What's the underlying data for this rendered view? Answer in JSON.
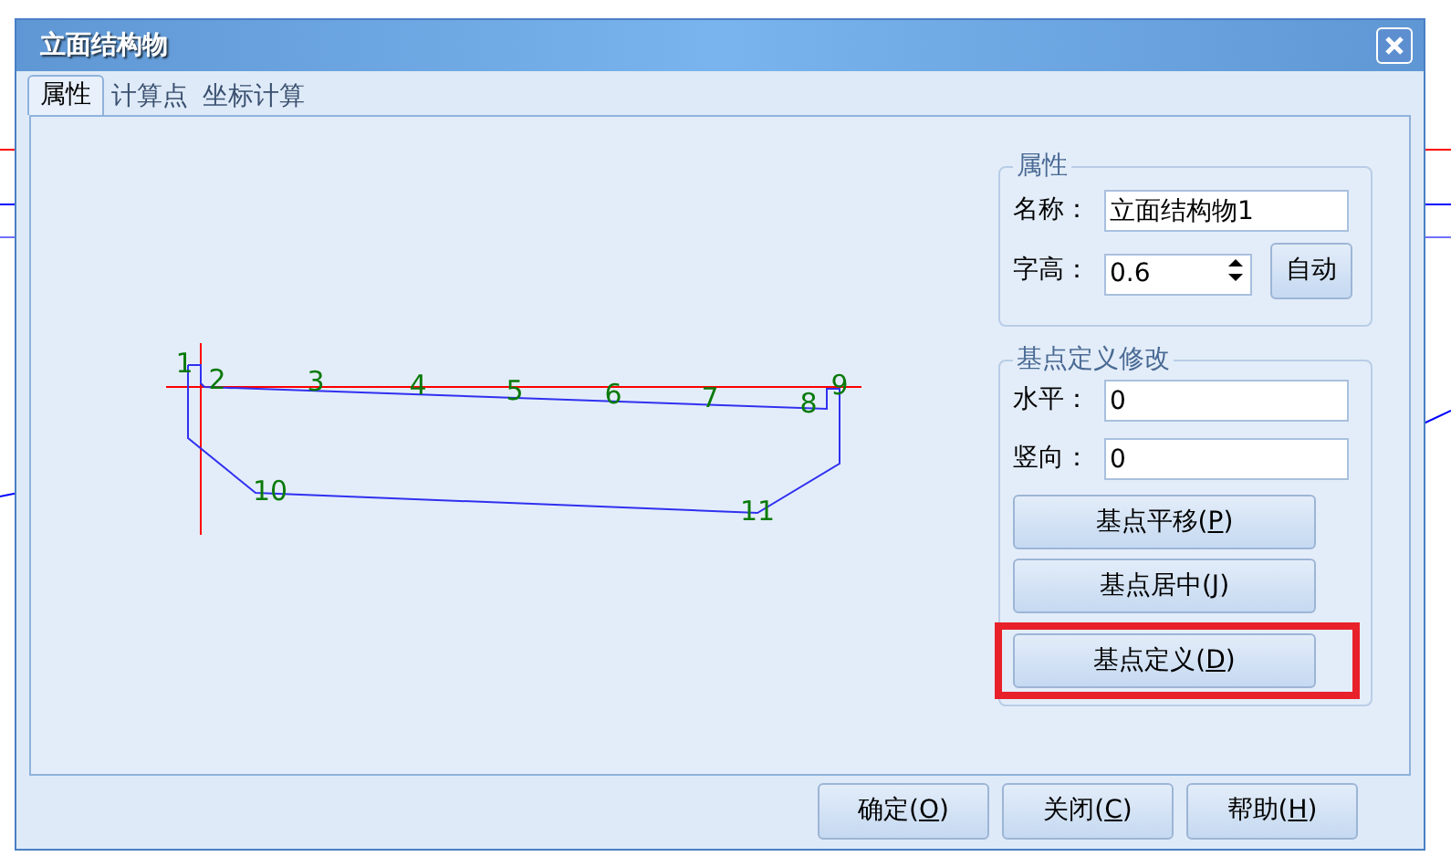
{
  "window": {
    "title": "立面结构物"
  },
  "tabs": [
    {
      "label": "属性",
      "selected": true
    },
    {
      "label": "计算点",
      "selected": false
    },
    {
      "label": "坐标计算",
      "selected": false
    }
  ],
  "points": [
    {
      "label": "1"
    },
    {
      "label": "2"
    },
    {
      "label": "3"
    },
    {
      "label": "4"
    },
    {
      "label": "5"
    },
    {
      "label": "6"
    },
    {
      "label": "7"
    },
    {
      "label": "8"
    },
    {
      "label": "9"
    },
    {
      "label": "10"
    },
    {
      "label": "11"
    }
  ],
  "properties": {
    "legend": "属性",
    "name_label": "名称：",
    "name_value": "立面结构物1",
    "height_label": "字高：",
    "height_value": "0.6",
    "auto_button": "自动"
  },
  "base_point": {
    "legend": "基点定义修改",
    "horizontal_label": "水平：",
    "horizontal_value": "0",
    "vertical_label": "竖向：",
    "vertical_value": "0",
    "buttons": [
      {
        "label": "基点平移(P)",
        "highlighted": false
      },
      {
        "label": "基点居中(J)",
        "highlighted": false
      },
      {
        "label": "基点定义(D)",
        "highlighted": true
      }
    ]
  },
  "footer_buttons": [
    {
      "label": "确定(O)"
    },
    {
      "label": "关闭(C)"
    },
    {
      "label": "帮助(H)"
    }
  ]
}
